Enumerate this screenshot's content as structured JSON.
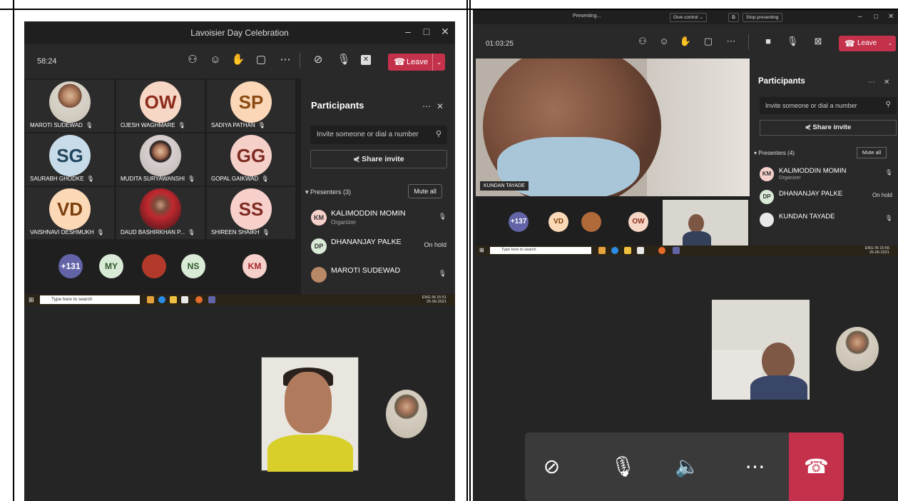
{
  "left": {
    "window_title": "Lavoisier Day Celebration",
    "timer": "58:24",
    "leave_label": "Leave",
    "grid": [
      {
        "name": "MAROTI SUDEWAD",
        "initials": "",
        "bg": "#cfc9bf"
      },
      {
        "name": "OJESH WAGHMARE",
        "initials": "OW",
        "bg": "#f6d6c4",
        "fg": "#8c2b1c"
      },
      {
        "name": "SADIYA PATHAN",
        "initials": "SP",
        "bg": "#fbd7b8",
        "fg": "#8a4b13"
      },
      {
        "name": "SAURABH GHODKE",
        "initials": "SG",
        "bg": "#c7dbe8",
        "fg": "#21465e"
      },
      {
        "name": "MUDITA SURYAWANSHI",
        "initials": "",
        "bg": "#d8d0d0"
      },
      {
        "name": "GOPAL GAIKWAD",
        "initials": "GG",
        "bg": "#f5d0c8",
        "fg": "#7d2a22"
      },
      {
        "name": "VAISHNAVI DESHMUKH",
        "initials": "VD",
        "bg": "#fcd9b6",
        "fg": "#7a3d0c"
      },
      {
        "name": "DAUD BASHIRKHAN P...",
        "initials": "",
        "bg": "#7a1d22"
      },
      {
        "name": "SHIREEN SHAIKH",
        "initials": "SS",
        "bg": "#f7d0cb",
        "fg": "#7f2a22"
      }
    ],
    "overflow": [
      {
        "label": "+131",
        "bg": "#6264a7",
        "fg": "#ffffff"
      },
      {
        "label": "MY",
        "bg": "#d9ead6",
        "fg": "#2f5a2a"
      },
      {
        "label": "",
        "bg": "#b33a2a"
      },
      {
        "label": "NS",
        "bg": "#d9ead6",
        "fg": "#2f5a2a"
      },
      {
        "label": "KM",
        "bg": "#f6d0cb",
        "fg": "#a3262a"
      }
    ],
    "participants": {
      "title": "Participants",
      "search_placeholder": "Invite someone or dial a number",
      "share_invite": "Share invite",
      "section": "Presenters (3)",
      "mute_all": "Mute all",
      "rows": [
        {
          "initials": "KM",
          "name": "KALIMODDIN MOMIN",
          "sub": "Organizer",
          "right": "🎙",
          "bg": "#f6d0cb"
        },
        {
          "initials": "DP",
          "name": "DHANANJAY PALKE",
          "sub": "",
          "right": "On hold",
          "bg": "#d9ead6"
        },
        {
          "initials": "",
          "name": "MAROTI SUDEWAD",
          "sub": "",
          "right": "🎙",
          "bg": "#b98866"
        }
      ]
    },
    "taskbar": {
      "search": "Type here to search",
      "time": "15:51",
      "date": "26-06-2021",
      "lang": "ENG IN"
    }
  },
  "right": {
    "presenting": "Presenting...",
    "give_control": "Give control",
    "stop_presenting": "Stop presenting",
    "timer": "01:03:25",
    "leave_label": "Leave",
    "main_speaker": "KUNDAN TAYADE",
    "overflow": [
      {
        "label": "+137",
        "bg": "#6264a7",
        "fg": "#ffffff"
      },
      {
        "label": "VD",
        "bg": "#fcd9b6",
        "fg": "#7a3d0c"
      },
      {
        "label": "",
        "bg": "#b06a3a"
      },
      {
        "label": "OW",
        "bg": "#f6d6c4",
        "fg": "#8c2b1c"
      }
    ],
    "participants": {
      "title": "Participants",
      "search_placeholder": "Invite someone or dial a number",
      "share_invite": "Share invite",
      "section": "Presenters (4)",
      "mute_all": "Mute all",
      "rows": [
        {
          "initials": "KM",
          "name": "KALIMODDIN MOMIN",
          "sub": "Organizer",
          "right": "🎙",
          "bg": "#f6d0cb"
        },
        {
          "initials": "DP",
          "name": "DHANANJAY PALKE",
          "sub": "",
          "right": "On hold",
          "bg": "#d9ead6"
        },
        {
          "initials": "",
          "name": "KUNDAN TAYADE",
          "sub": "",
          "right": "🎙",
          "bg": "#e9e9e9"
        }
      ]
    },
    "taskbar": {
      "search": "Type here to search",
      "time": "15:56",
      "date": "26-06-2021",
      "lang": "ENG IN"
    }
  }
}
